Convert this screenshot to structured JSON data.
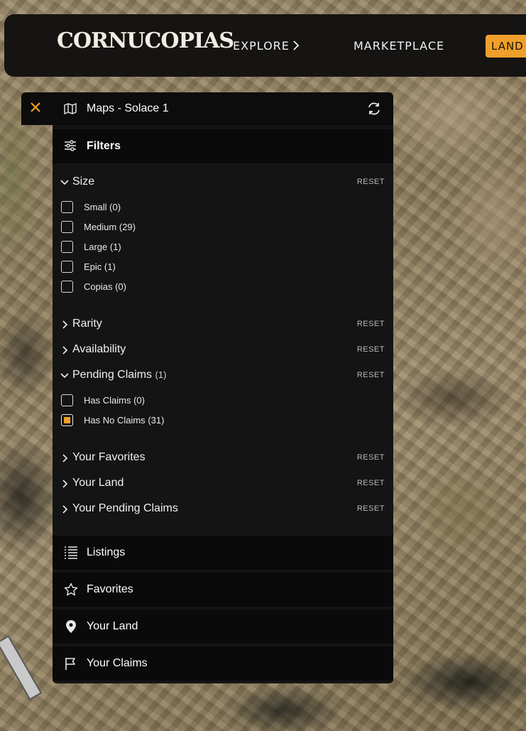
{
  "nav": {
    "logo": "CORNUCOPIAS",
    "explore": "EXPLORE",
    "marketplace": "MARKETPLACE",
    "land_button": "LAND O"
  },
  "panel": {
    "title": "Maps - Solace 1",
    "filters_label": "Filters",
    "reset_label": "RESET",
    "size": {
      "label": "Size",
      "options": [
        {
          "label": "Small",
          "count": "(0)",
          "checked": false
        },
        {
          "label": "Medium",
          "count": "(29)",
          "checked": false
        },
        {
          "label": "Large",
          "count": "(1)",
          "checked": false
        },
        {
          "label": "Epic",
          "count": "(1)",
          "checked": false
        },
        {
          "label": "Copias",
          "count": "(0)",
          "checked": false
        }
      ]
    },
    "rarity": "Rarity",
    "availability": "Availability",
    "pending_claims": {
      "label": "Pending Claims",
      "count": "(1)",
      "options": [
        {
          "label": "Has Claims",
          "count": "(0)",
          "checked": false
        },
        {
          "label": "Has No Claims",
          "count": "(31)",
          "checked": true
        }
      ]
    },
    "your_favorites": "Your Favorites",
    "your_land": "Your Land",
    "your_pending_claims": "Your Pending Claims",
    "bottom": {
      "listings": "Listings",
      "favorites": "Favorites",
      "your_land": "Your Land",
      "your_claims": "Your Claims"
    }
  },
  "colors": {
    "accent": "#f0a02a",
    "panel": "#141414",
    "bar": "#0a0a0a"
  }
}
